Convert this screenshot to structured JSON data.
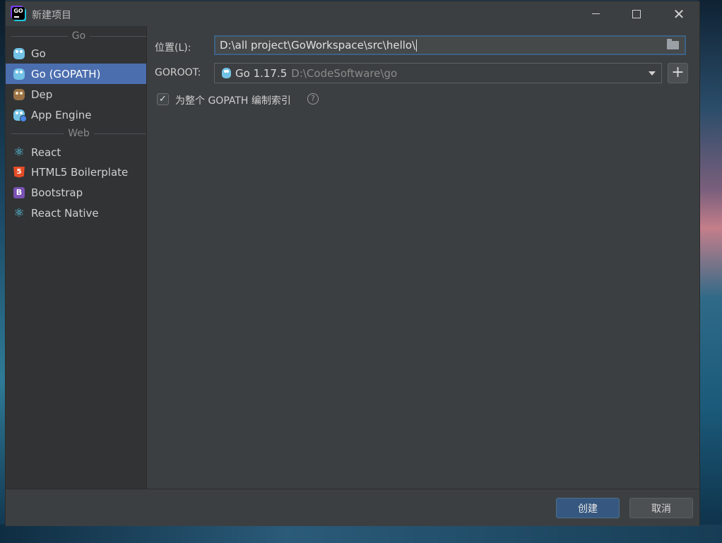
{
  "window": {
    "title": "新建项目",
    "icon": "goland-icon"
  },
  "sidebar": {
    "groups": [
      {
        "label": "Go",
        "items": [
          {
            "label": "Go",
            "icon": "gopher-icon",
            "selected": false
          },
          {
            "label": "Go (GOPATH)",
            "icon": "gopher-icon",
            "selected": true
          },
          {
            "label": "Dep",
            "icon": "dep-icon",
            "selected": false
          },
          {
            "label": "App Engine",
            "icon": "app-engine-icon",
            "selected": false
          }
        ]
      },
      {
        "label": "Web",
        "items": [
          {
            "label": "React",
            "icon": "react-icon",
            "selected": false
          },
          {
            "label": "HTML5 Boilerplate",
            "icon": "html5-icon",
            "selected": false
          },
          {
            "label": "Bootstrap",
            "icon": "bootstrap-icon",
            "selected": false
          },
          {
            "label": "React Native",
            "icon": "react-icon",
            "selected": false
          }
        ]
      }
    ]
  },
  "form": {
    "location_label": "位置(L):",
    "location_value": "D:\\all project\\GoWorkspace\\src\\hello\\",
    "goroot_label": "GOROOT:",
    "goroot_version": "Go 1.17.5",
    "goroot_path": "D:\\CodeSoftware\\go",
    "index_checkbox_label": "为整个 GOPATH 编制索引",
    "index_checked": true
  },
  "footer": {
    "create_label": "创建",
    "cancel_label": "取消"
  },
  "colors": {
    "accent": "#4b6eaf",
    "background": "#3c3f41",
    "sidebar": "#313335"
  }
}
